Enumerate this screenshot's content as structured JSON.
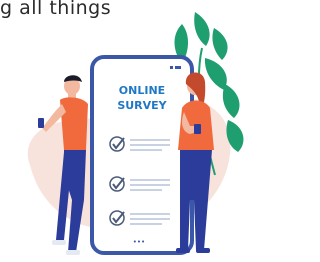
{
  "caption": "g all things",
  "phone": {
    "title_line1": "ONLINE",
    "title_line2": "SURVEY",
    "footer_dots": "•••"
  },
  "colors": {
    "blob": "#f8e3dc",
    "leaf": "#1f9e70",
    "phone_border": "#3b57a8",
    "accent": "#1f78c6",
    "shirt": "#f06a3d",
    "pants": "#2c3c9a"
  },
  "survey_items": [
    {
      "state": "checked"
    },
    {
      "state": "checked"
    },
    {
      "state": "checked"
    }
  ]
}
